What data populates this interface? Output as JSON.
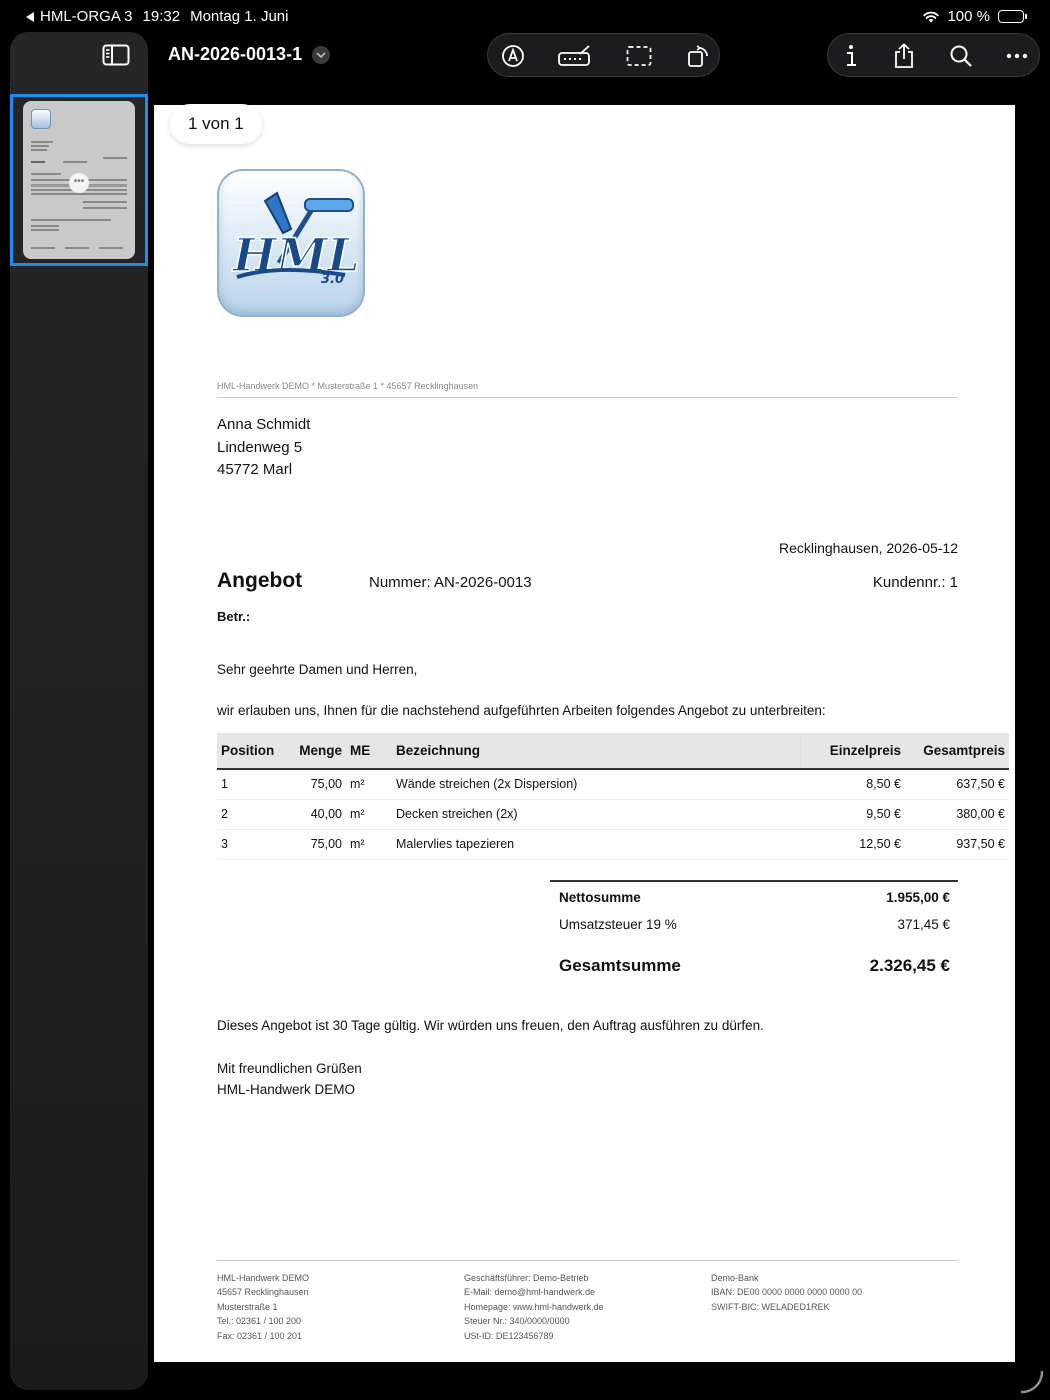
{
  "status_bar": {
    "back_app": "HML-ORGA 3",
    "time": "19:32",
    "date": "Montag 1. Juni",
    "battery": "100 %"
  },
  "toolbar": {
    "document_title": "AN-2026-0013-1"
  },
  "viewer": {
    "page_counter": "1 von 1"
  },
  "document": {
    "sender_line": "HML-Handwerk DEMO * Musterstraße 1 * 45657 Recklinghausen",
    "recipient": {
      "name": "Anna Schmidt",
      "street": "Lindenweg 5",
      "city": "45772 Marl"
    },
    "place_date": "Recklinghausen, 2026-05-12",
    "heading": "Angebot",
    "number": "Nummer: AN-2026-0013",
    "customer_no": "Kundennr.: 1",
    "subject_label": "Betr.:",
    "salutation": "Sehr geehrte Damen und Herren,",
    "intro": "wir erlauben uns, Ihnen für die nachstehend aufgeführten Arbeiten folgendes Angebot zu unterbreiten:",
    "table": {
      "headers": {
        "position": "Position",
        "quantity": "Menge",
        "unit": "ME",
        "description": "Bezeichnung",
        "unit_price": "Einzelpreis",
        "total_price": "Gesamtpreis"
      },
      "rows": [
        {
          "position": "1",
          "quantity": "75,00",
          "unit": "m²",
          "description": "Wände streichen (2x Dispersion)",
          "unit_price": "8,50 €",
          "total_price": "637,50 €"
        },
        {
          "position": "2",
          "quantity": "40,00",
          "unit": "m²",
          "description": "Decken streichen (2x)",
          "unit_price": "9,50 €",
          "total_price": "380,00 €"
        },
        {
          "position": "3",
          "quantity": "75,00",
          "unit": "m²",
          "description": "Malervlies tapezieren",
          "unit_price": "12,50 €",
          "total_price": "937,50 €"
        }
      ]
    },
    "totals": {
      "net_label": "Nettosumme",
      "net_value": "1.955,00 €",
      "vat_label": "Umsatzsteuer 19 %",
      "vat_value": "371,45 €",
      "grand_label": "Gesamtsumme",
      "grand_value": "2.326,45 €"
    },
    "validity": "Dieses Angebot ist 30 Tage gültig. Wir würden uns freuen, den Auftrag ausführen zu dürfen.",
    "closing": "Mit freundlichen Grüßen",
    "signature": "HML-Handwerk DEMO",
    "footer": {
      "col1": [
        "HML-Handwerk DEMO",
        "45657 Recklinghausen",
        "Musterstraße 1",
        "Tel.: 02361 / 100 200",
        "Fax: 02361 / 100 201"
      ],
      "col2": [
        "Geschäftsführer: Demo-Betrieb",
        "E-Mail: demo@hml-handwerk.de",
        "Homepage: www.hml-handwerk.de",
        "Steuer Nr.: 340/0000/0000",
        "USt-ID: DE123456789"
      ],
      "col3": [
        "Demo-Bank",
        "IBAN: DE00 0000 0000 0000 0000 00",
        "SWIFT-BIC: WELADED1REK"
      ]
    }
  },
  "colors": {
    "accent": "#1d8ef0",
    "toolbar_bg": "#1c1c1e",
    "page_bg": "#ffffff"
  }
}
